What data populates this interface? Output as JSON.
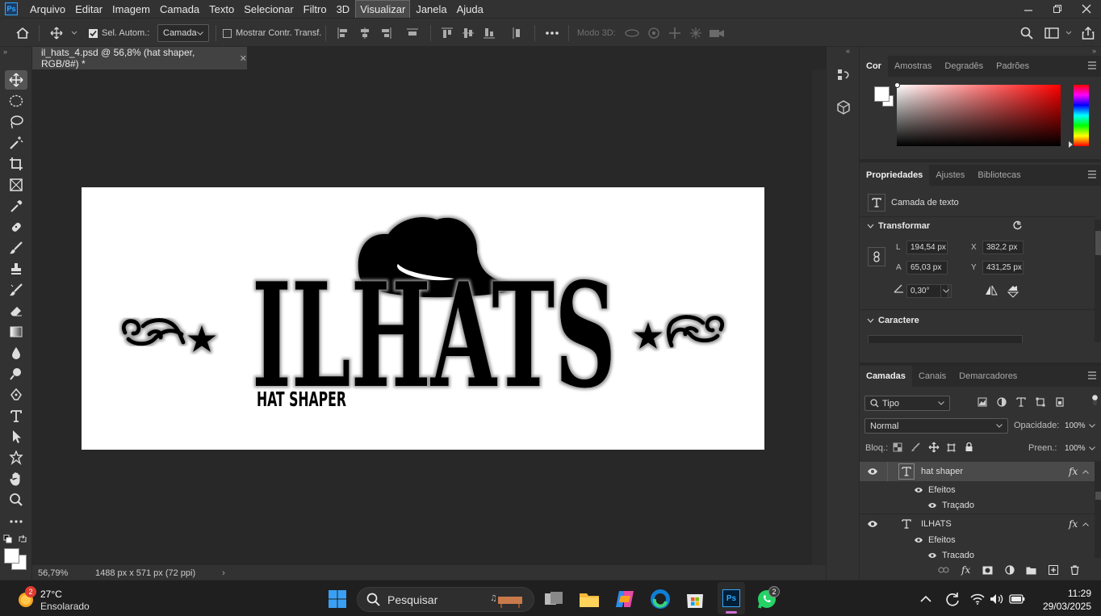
{
  "menubar": {
    "app_icon": "Ps",
    "items": [
      "Arquivo",
      "Editar",
      "Imagem",
      "Camada",
      "Texto",
      "Selecionar",
      "Filtro",
      "3D",
      "Visualizar",
      "Janela",
      "Ajuda"
    ],
    "active_item": "Visualizar"
  },
  "optionsbar": {
    "auto_select_label": "Sel. Autom.:",
    "auto_select_checked": true,
    "auto_select_target": "Camada",
    "show_transform_label": "Mostrar Contr. Transf.",
    "mode_3d_label": "Modo 3D:"
  },
  "document": {
    "tab_title": "il_hats_4.psd @ 56,8% (hat shaper, RGB/8#) *",
    "zoom": "56,79%",
    "size_info": "1488 px x 571 px (72 ppi)"
  },
  "artwork": {
    "main_text": "ILHATS",
    "sub_text": "HAT SHAPER",
    "color": "#000000"
  },
  "color_panel": {
    "tabs": [
      "Cor",
      "Amostras",
      "Degradês",
      "Padrões"
    ],
    "active_tab": "Cor",
    "foreground": "#ffffff",
    "background": "#ffffff",
    "hue_color": "#ff0000"
  },
  "properties": {
    "tabs": [
      "Propriedades",
      "Ajustes",
      "Bibliotecas"
    ],
    "active_tab": "Propriedades",
    "layer_kind": "Camada de texto",
    "transform_title": "Transformar",
    "w_label": "L",
    "w": "194,54 px",
    "x_label": "X",
    "x": "382,2 px",
    "h_label": "A",
    "h": "65,03 px",
    "y_label": "Y",
    "y": "431,25 px",
    "angle": "0,30°",
    "character_title": "Caractere"
  },
  "layers_panel": {
    "tabs": [
      "Camadas",
      "Canais",
      "Demarcadores"
    ],
    "active_tab": "Camadas",
    "filter_kind": "Tipo",
    "blend_mode": "Normal",
    "opacity_label": "Opacidade:",
    "opacity": "100%",
    "lock_label": "Bloq.:",
    "fill_label": "Preen.:",
    "fill": "100%",
    "layers": [
      {
        "name": "hat shaper",
        "effects_label": "Efeitos",
        "effect": "Traçado",
        "selected": true
      },
      {
        "name": "ILHATS",
        "effects_label": "Efeitos",
        "effect": "Traçado",
        "selected": false
      }
    ]
  },
  "taskbar": {
    "weather_temp": "27°C",
    "weather_desc": "Ensolarado",
    "weather_badge": "2",
    "search_placeholder": "Pesquisar",
    "whatsapp_badge": "2",
    "time": "11:29",
    "date": "29/03/2025"
  }
}
